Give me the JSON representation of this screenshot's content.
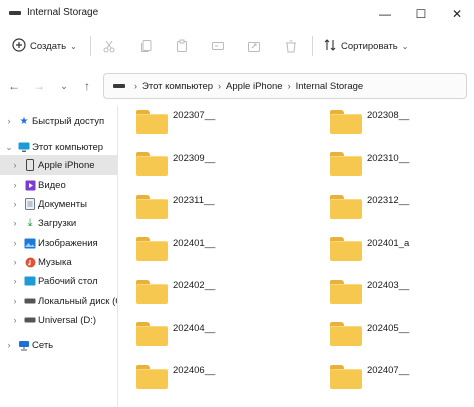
{
  "window": {
    "title": "Internal Storage",
    "minimize_glyph": "—",
    "maximize_glyph": "☐",
    "close_glyph": "✕"
  },
  "toolbar": {
    "create_label": "Создать",
    "sort_label": "Сортировать"
  },
  "breadcrumb": [
    "Этот компьютер",
    "Apple iPhone",
    "Internal Storage"
  ],
  "sidebar": {
    "items": [
      {
        "label": "Быстрый доступ",
        "icon": "star-icon",
        "color": "#1e6fd9"
      },
      {
        "label": "Этот компьютер",
        "icon": "computer-icon",
        "color": "#1e6fd9"
      },
      {
        "label": "Apple iPhone",
        "icon": "phone-icon",
        "color": "#444444"
      },
      {
        "label": "Видео",
        "icon": "video-icon",
        "color": "#7a3bd1"
      },
      {
        "label": "Документы",
        "icon": "document-icon",
        "color": "#6b7a8f"
      },
      {
        "label": "Загрузки",
        "icon": "download-icon",
        "color": "#1e8f3a"
      },
      {
        "label": "Изображения",
        "icon": "image-icon",
        "color": "#1e7ad9"
      },
      {
        "label": "Музыка",
        "icon": "music-icon",
        "color": "#e0533b"
      },
      {
        "label": "Рабочий стол",
        "icon": "desktop-icon",
        "color": "#1e9ad9"
      },
      {
        "label": "Локальный диск (C",
        "icon": "drive-icon",
        "color": "#555555"
      },
      {
        "label": "Universal (D:)",
        "icon": "drive-icon",
        "color": "#555555"
      },
      {
        "label": "Сеть",
        "icon": "network-icon",
        "color": "#1e6fd9"
      }
    ]
  },
  "folders": [
    "202307__",
    "202308__",
    "202309__",
    "202310__",
    "202311__",
    "202312__",
    "202401__",
    "202401_a",
    "202402__",
    "202403__",
    "202404__",
    "202405__",
    "202406__",
    "202407__"
  ]
}
